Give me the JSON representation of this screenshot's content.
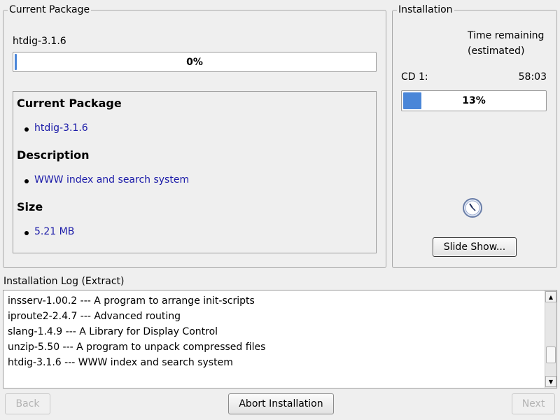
{
  "current_package": {
    "group_title": "Current Package",
    "package_name": "htdig-3.1.6",
    "progress_text": "0%",
    "progress_value": 0,
    "details": {
      "heading_package": "Current Package",
      "package_value": "htdig-3.1.6",
      "heading_description": "Description",
      "description_value": "WWW index and search system",
      "heading_size": "Size",
      "size_value": "5.21 MB"
    }
  },
  "installation": {
    "group_title": "Installation",
    "time_remaining_line1": "Time remaining",
    "time_remaining_line2": "(estimated)",
    "cd_label": "CD 1:",
    "cd_time": "58:03",
    "progress_text": "13%",
    "progress_value": 13,
    "slideshow_label": "Slide Show...",
    "busy_icon": "clock-icon"
  },
  "log": {
    "label": "Installation Log (Extract)",
    "lines": [
      "insserv-1.00.2 --- A program to arrange init-scripts",
      "iproute2-2.4.7 --- Advanced routing",
      "slang-1.4.9 --- A Library for Display Control",
      "unzip-5.50 --- A program to unpack compressed files",
      "htdig-3.1.6 --- WWW index and search system"
    ]
  },
  "buttons": {
    "back": "Back",
    "abort": "Abort Installation",
    "next": "Next"
  },
  "colors": {
    "accent": "#4a86d8",
    "link_text": "#1a1aa8",
    "background": "#efefef"
  }
}
